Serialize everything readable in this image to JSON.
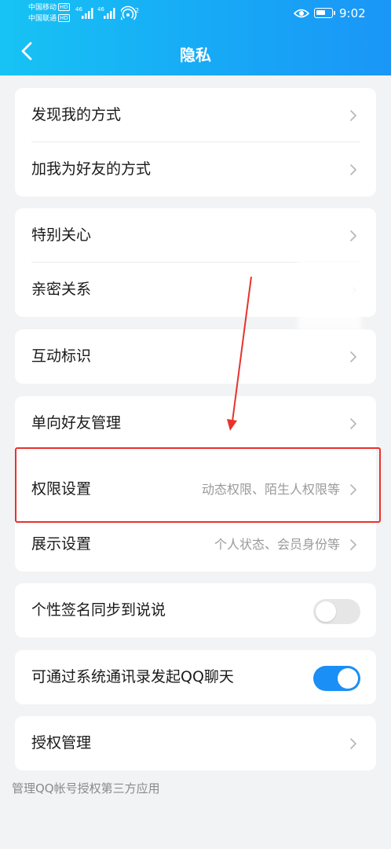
{
  "status_bar": {
    "carrier1": "中国移动",
    "carrier2": "中国联通",
    "hd": "HD",
    "sig1": "46",
    "sig2": "46",
    "hotspot": "2",
    "time": "9:02"
  },
  "nav": {
    "title": "隐私",
    "back_icon": "chevron-left-icon"
  },
  "sections": {
    "s1": {
      "items": [
        {
          "label": "发现我的方式"
        },
        {
          "label": "加我为好友的方式"
        }
      ]
    },
    "s2": {
      "items": [
        {
          "label": "特别关心"
        },
        {
          "label": "亲密关系"
        }
      ]
    },
    "s3": {
      "items": [
        {
          "label": "互动标识"
        }
      ]
    },
    "s4": {
      "items": [
        {
          "label": "单向好友管理"
        },
        {
          "label": "权限设置",
          "value": "动态权限、陌生人权限等"
        },
        {
          "label": "展示设置",
          "value": "个人状态、会员身份等"
        }
      ]
    },
    "s5": {
      "label": "个性签名同步到说说",
      "toggle_on": false
    },
    "s6": {
      "label": "可通过系统通讯录发起QQ聊天",
      "toggle_on": true
    },
    "s7": {
      "label": "授权管理"
    }
  },
  "footnote": "管理QQ帐号授权第三方应用",
  "colors": {
    "header_gradient": [
      "#17c3f4",
      "#1a96f7"
    ],
    "toggle_on": "#1a8ff5",
    "annotation": "#e8322c",
    "background": "#f2f3f5"
  }
}
